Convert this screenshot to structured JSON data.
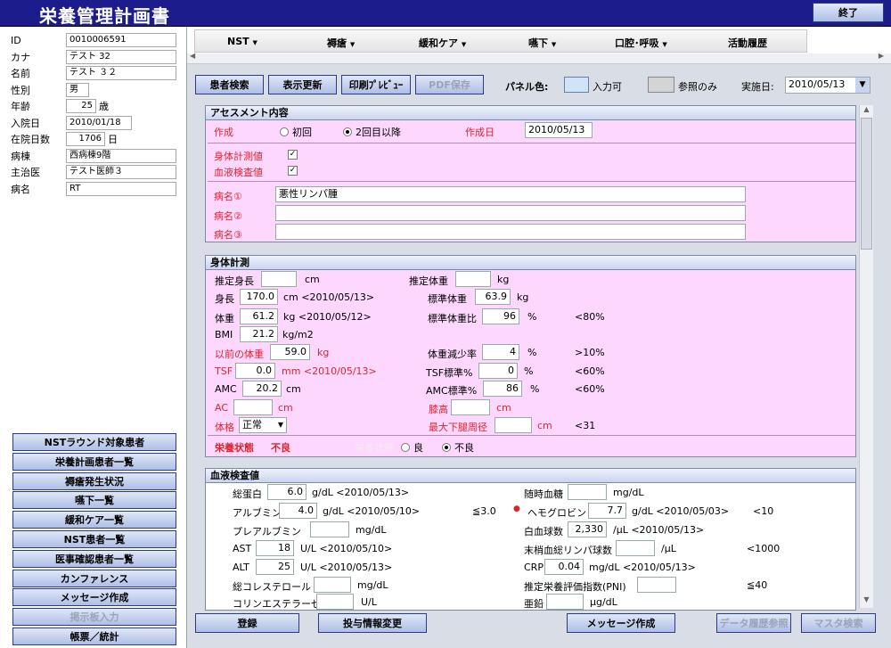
{
  "app": {
    "title": "栄養管理計画書",
    "end_label": "終了"
  },
  "patient": {
    "rows": [
      {
        "label": "ID",
        "value": "0010006591"
      },
      {
        "label": "カナ",
        "value": "テスト 32"
      },
      {
        "label": "名前",
        "value": "テスト ３２"
      },
      {
        "label": "性別",
        "value": "男"
      },
      {
        "label": "年齢",
        "value": "25",
        "unit": "歳"
      },
      {
        "label": "入院日",
        "value": "2010/01/18"
      },
      {
        "label": "在院日数",
        "value": "1706",
        "unit": "日"
      },
      {
        "label": "病棟",
        "value": "西病棟9階"
      },
      {
        "label": "主治医",
        "value": "テスト医師３"
      },
      {
        "label": "病名",
        "value": "RT"
      }
    ]
  },
  "nav": [
    "NSTラウンド対象患者",
    "栄養計画患者一覧",
    "褥瘡発生状況",
    "嚥下一覧",
    "緩和ケア一覧",
    "NST患者一覧",
    "医事確認患者一覧",
    "カンファレンス",
    "メッセージ作成",
    "掲示板入力",
    "帳票／統計"
  ],
  "menu": [
    {
      "label": "NST",
      "arrow": "▼"
    },
    {
      "label": "褥瘡",
      "arrow": "▼"
    },
    {
      "label": "緩和ケア",
      "arrow": "▼"
    },
    {
      "label": "嚥下",
      "arrow": "▼"
    },
    {
      "label": "口腔･呼吸",
      "arrow": "▼"
    },
    {
      "label": "活動履歴"
    }
  ],
  "toolbar": {
    "search": "患者検索",
    "refresh": "表示更新",
    "preview": "印刷ﾌﾟﾚﾋﾞｭｰ",
    "pdf": "PDF保存",
    "panel_color": "パネル色:",
    "input_ok": "入力可",
    "ref_only": "参照のみ",
    "date_label": "実施日:",
    "date": "2010/05/13"
  },
  "assess": {
    "title": "アセスメント内容",
    "create": "作成",
    "first": "初回",
    "second": "2回目以降",
    "created_date_label": "作成日",
    "created_date": "2010/05/13",
    "body": "身体計測値",
    "blood": "血液検査値",
    "d1": "病名①",
    "d1v": "悪性リンパ腫",
    "d2": "病名②",
    "d3": "病名③"
  },
  "body": {
    "title": "身体計測",
    "est_h": "推定身長",
    "cm": "cm",
    "est_w": "推定体重",
    "kg": "kg",
    "height": "身長",
    "height_v": "170.0",
    "height_d": "cm <2010/05/13>",
    "std_w": "標準体重",
    "std_w_v": "63.9",
    "weight": "体重",
    "weight_v": "61.2",
    "weight_d": "kg <2010/05/12>",
    "std_ratio": "標準体重比",
    "std_ratio_v": "96",
    "pct": "%",
    "lt80": "<80%",
    "bmi": "BMI",
    "bmi_v": "21.2",
    "bmi_u": "kg/m2",
    "prev_w": "以前の体重",
    "prev_w_v": "59.0",
    "loss": "体重減少率",
    "loss_v": "4",
    "gt10": ">10%",
    "tsf": "TSF",
    "tsf_v": "0.0",
    "tsf_d": "mm <2010/05/13>",
    "tsf_std": "TSF標準%",
    "tsf_std_v": "0",
    "lt60": "<60%",
    "amc": "AMC",
    "amc_v": "20.2",
    "amc_std": "AMC標準%",
    "amc_std_v": "86",
    "ac": "AC",
    "knee": "膝高",
    "frame": "体格",
    "frame_v": "正常",
    "calf": "最大下腿周径",
    "lt31": "<31",
    "status": "栄養状態",
    "status_v": "不良",
    "status2": "栄養状態",
    "good": "良",
    "bad": "不良"
  },
  "blood": {
    "title": "血液検査値",
    "tp": "総蛋白",
    "tp_v": "6.0",
    "tp_d": "g/dL <2010/05/13>",
    "bs": "随時血糖",
    "bs_u": "mg/dL",
    "alb": "アルブミン",
    "alb_v": "4.0",
    "alb_d": "g/dL <2010/05/10>",
    "alb_th": "≦3.0",
    "hb": "ヘモグロビン",
    "hb_v": "7.7",
    "hb_d": "g/dL <2010/05/03>",
    "hb_th": "<10",
    "pa": "プレアルブミン",
    "pa_u": "mg/dL",
    "wbc": "白血球数",
    "wbc_v": "2,330",
    "wbc_d": "/μL <2010/05/13>",
    "ast": "AST",
    "ast_v": "18",
    "ast_d": "U/L <2010/05/10>",
    "lym": "末梢血総リンパ球数",
    "lym_u": "/μL",
    "lym_th": "<1000",
    "alt": "ALT",
    "alt_v": "25",
    "alt_d": "U/L <2010/05/13>",
    "crp": "CRP",
    "crp_v": "0.04",
    "crp_d": "mg/dL <2010/05/13>",
    "tc": "総コレステロール",
    "tc_u": "mg/dL",
    "pni": "推定栄養評価指数(PNI)",
    "pni_th": "≦40",
    "che": "コリンエステラーゼ",
    "che_u": "U/L",
    "zn": "亜鉛",
    "zn_u": "μg/dL"
  },
  "bottom": {
    "register": "登録",
    "dose": "投与情報変更",
    "msg": "メッセージ作成",
    "history": "データ履歴参照",
    "master": "マスタ検索"
  },
  "colors": {
    "title_bar": "#1c1c8c",
    "panel_pink": "#fdd7fd",
    "input_ok": "#d0e4f8",
    "ref_only": "#d4d4d4",
    "accent_red": "#e0242c"
  }
}
